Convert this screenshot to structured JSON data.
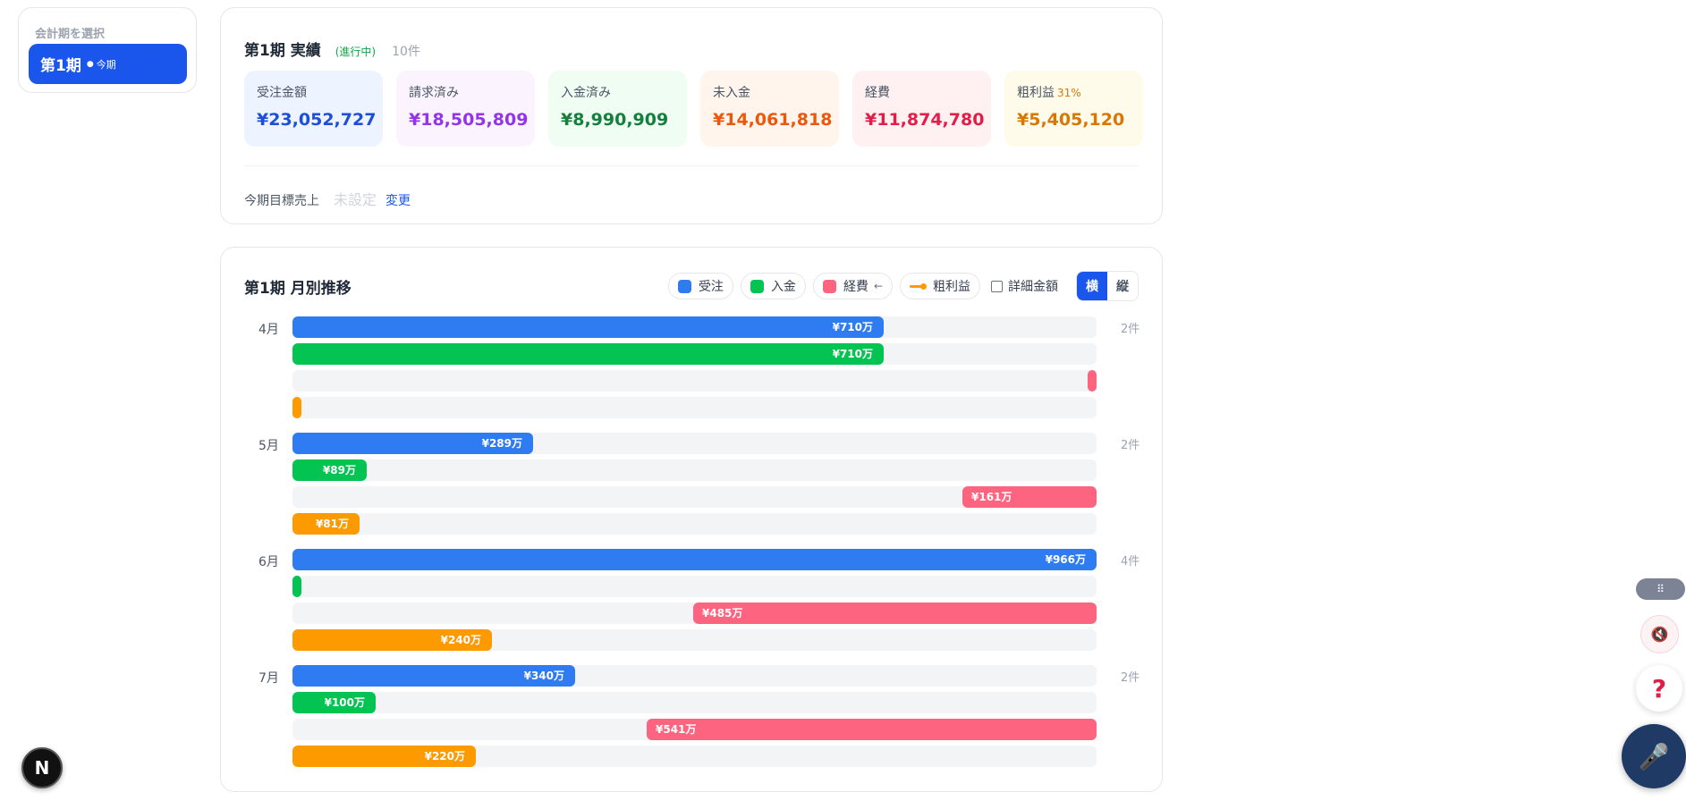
{
  "sidebar": {
    "title": "会計期を選択",
    "period": {
      "name": "第1期",
      "dot": "●",
      "sub": "今期"
    }
  },
  "summary": {
    "title": "第1期 実績",
    "status": "(進行中)",
    "count": "10件",
    "kpis": [
      {
        "label": "受注金額",
        "value": "¥23,052,727",
        "bg": "#eef4ff",
        "color": "#1d4ed8"
      },
      {
        "label": "請求済み",
        "value": "¥18,505,809",
        "bg": "#fbf4ff",
        "color": "#9333ea"
      },
      {
        "label": "入金済み",
        "value": "¥8,990,909",
        "bg": "#effdf3",
        "color": "#15803d"
      },
      {
        "label": "未入金",
        "value": "¥14,061,818",
        "bg": "#fff5ec",
        "color": "#ea580c"
      },
      {
        "label": "経費",
        "value": "¥11,874,780",
        "bg": "#fff0f2",
        "color": "#e11d48"
      },
      {
        "label": "粗利益",
        "pct": "31%",
        "value": "¥5,405,120",
        "bg": "#fffbea",
        "color": "#d97706"
      }
    ],
    "target": {
      "label": "今期目標売上",
      "value": "未設定",
      "change": "変更"
    }
  },
  "monthly": {
    "title": "第1期 月別推移",
    "legend": {
      "order": "受注",
      "payment": "入金",
      "expense": "経費",
      "expense_arrow": "←",
      "profit": "粗利益",
      "detail": "詳細金額",
      "horizontal": "横",
      "vertical": "縦"
    },
    "colors": {
      "order": "#2f7bf2",
      "payment": "#03c452",
      "expense": "#fd6480",
      "profit": "#fd9a00"
    }
  },
  "chart_data": {
    "type": "bar",
    "orientation": "horizontal",
    "title": "第1期 月別推移",
    "unit": "万",
    "categories": [
      "4月",
      "5月",
      "6月",
      "7月"
    ],
    "counts": [
      "2件",
      "2件",
      "4件",
      "2件"
    ],
    "series": [
      {
        "name": "受注",
        "values": [
          710,
          289,
          966,
          340
        ],
        "labels": [
          "¥710万",
          "¥289万",
          "¥966万",
          "¥340万"
        ],
        "direction": "ltr",
        "color": "#2f7bf2"
      },
      {
        "name": "入金",
        "values": [
          710,
          89,
          0,
          100
        ],
        "labels": [
          "¥710万",
          "¥89万",
          "",
          "¥100万"
        ],
        "direction": "ltr",
        "color": "#03c452"
      },
      {
        "name": "経費",
        "values": [
          0,
          161,
          485,
          541
        ],
        "labels": [
          "",
          "¥161万",
          "¥485万",
          "¥541万"
        ],
        "direction": "rtl",
        "color": "#fd6480"
      },
      {
        "name": "粗利益",
        "values": [
          0,
          81,
          240,
          220
        ],
        "labels": [
          "",
          "¥81万",
          "¥240万",
          "¥220万"
        ],
        "direction": "ltr",
        "color": "#fd9a00"
      }
    ],
    "xlim": [
      0,
      966
    ]
  },
  "floating": {
    "next": "N",
    "drag": "⠿",
    "mute": "🔇",
    "help": "?",
    "mic": "🎤"
  }
}
